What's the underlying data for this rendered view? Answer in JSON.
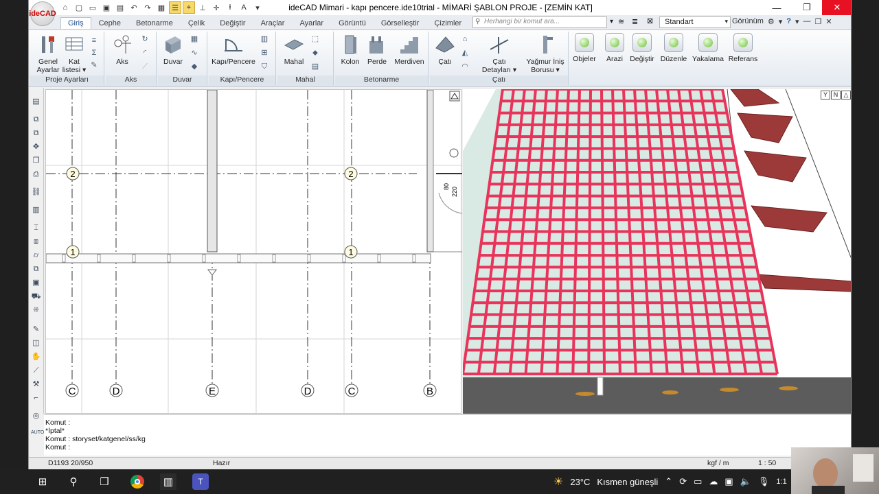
{
  "app": {
    "logo_text": "ideCAD",
    "title": "ideCAD Mimari - kapı pencere.ide10trial - MİMARİ ŞABLON PROJE - [ZEMİN KAT]",
    "window_buttons": {
      "minimize": "—",
      "restore": "❐",
      "close": "✕"
    }
  },
  "tabs": [
    "Giriş",
    "Cephe",
    "Betonarme",
    "Çelik",
    "Değiştir",
    "Araçlar",
    "Ayarlar",
    "Görüntü",
    "Görselleştir",
    "Çizimler"
  ],
  "command_search": {
    "placeholder": "Herhangi bir komut ara..."
  },
  "style_select": {
    "value": "Standart"
  },
  "view_label": "Görünüm",
  "ribbon": {
    "groups": {
      "proje": "Proje Ayarları",
      "aks": "Aks",
      "duvar": "Duvar",
      "kapi": "Kapı/Pencere",
      "mahal": "Mahal",
      "betonarme": "Betonarme",
      "cati": "Çatı"
    },
    "buttons": {
      "genel_ayarlar": [
        "Genel",
        "Ayarlar"
      ],
      "kat_listesi": [
        "Kat",
        "listesi ▾"
      ],
      "aks": "Aks",
      "duvar": "Duvar",
      "kapi_pencere": "Kapı/Pencere",
      "mahal": "Mahal",
      "kolon": "Kolon",
      "perde": "Perde",
      "merdiven": "Merdiven",
      "cati": "Çatı",
      "cati_detaylari": [
        "Çatı",
        "Detayları ▾"
      ],
      "yagmur": [
        "Yağmur İniş",
        "Borusu ▾"
      ],
      "objeler": "Objeler",
      "arazi": "Arazi",
      "degistir": "Değiştir",
      "duzenle": "Düzenle",
      "yakalama": "Yakalama",
      "referans": "Referans"
    }
  },
  "plan": {
    "axis_labels_bottom": [
      "C",
      "D",
      "E",
      "D",
      "C",
      "B"
    ],
    "axis_labels_row": [
      "2",
      "1"
    ],
    "dim_80": "80",
    "dim_220": "220"
  },
  "viewport3d": {
    "nav_buttons": [
      "Y",
      "N",
      "△"
    ]
  },
  "command_log": [
    "Komut :",
    "*İptal*",
    "Komut : storyset/katgenel/ss/kg",
    "Komut :"
  ],
  "status": {
    "coords": "D1193 20/950",
    "state": "Hazır",
    "units": "kgf / m",
    "scale": "1 : 50"
  },
  "taskbar": {
    "weather_temp": "23°C",
    "weather_desc": "Kısmen güneşli",
    "time_partial": "1:1"
  },
  "colors": {
    "accent": "#1f4e8c",
    "rebar": "#e8345a",
    "close": "#e81123"
  }
}
